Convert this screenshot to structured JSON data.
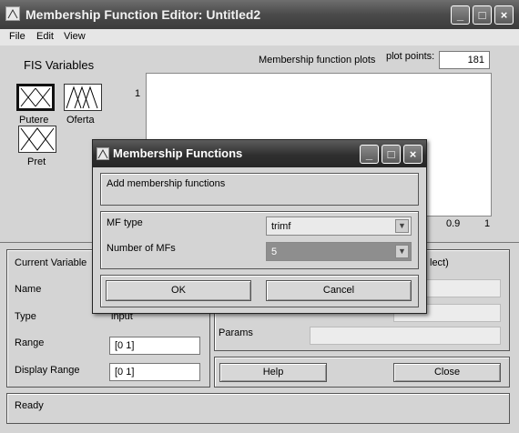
{
  "window": {
    "title": "Membership Function Editor: Untitled2"
  },
  "menu": [
    "File",
    "Edit",
    "View"
  ],
  "fis": {
    "heading": "FIS Variables",
    "vars": [
      {
        "label": "Putere",
        "selected": true
      },
      {
        "label": "Oferta",
        "selected": false
      },
      {
        "label": "Pret",
        "selected": false
      }
    ]
  },
  "plot": {
    "title": "Membership function plots",
    "points_label": "plot points:",
    "points_value": "181",
    "y_tick_top": "1",
    "x_ticks": [
      "0.9",
      "1"
    ]
  },
  "current_variable": {
    "heading": "Current Variable",
    "name_label": "Name",
    "type_label": "Type",
    "type_value": "input",
    "range_label": "Range",
    "range_value": "[0 1]",
    "display_range_label": "Display Range",
    "display_range_value": "[0 1]"
  },
  "current_mf": {
    "heading_partial": "lect)",
    "params_label": "Params"
  },
  "buttons": {
    "help": "Help",
    "close": "Close"
  },
  "status": "Ready",
  "dialog": {
    "title": "Membership Functions",
    "subtitle": "Add membership functions",
    "mf_type_label": "MF type",
    "mf_type_value": "trimf",
    "num_mfs_label": "Number of MFs",
    "num_mfs_value": "5",
    "ok": "OK",
    "cancel": "Cancel"
  },
  "colors": {
    "titlebar": "#4a4a4a",
    "dialog_titlebar": "#2f2f2f",
    "background": "#d4d4d4"
  }
}
